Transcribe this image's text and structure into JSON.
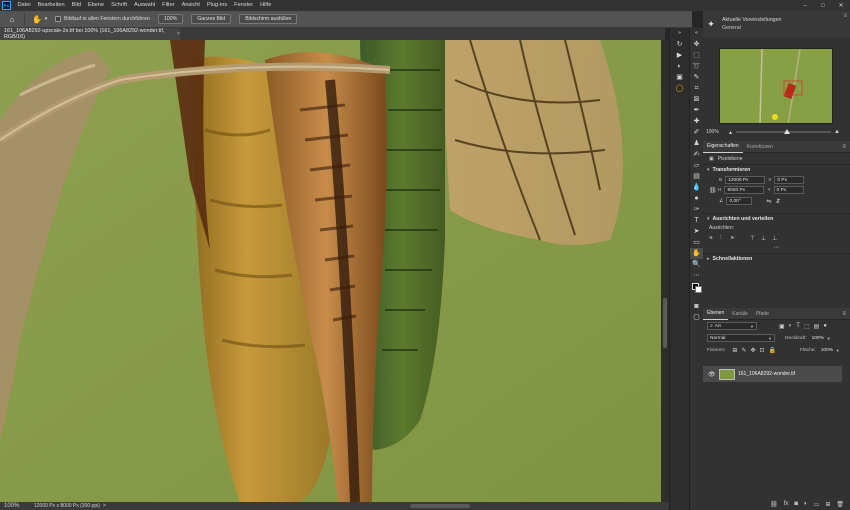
{
  "menu": {
    "logo": "Ps",
    "items": [
      "Datei",
      "Bearbeiten",
      "Bild",
      "Ebene",
      "Schrift",
      "Auswahl",
      "Filter",
      "Ansicht",
      "Plug-ins",
      "Fenster",
      "Hilfe"
    ]
  },
  "options": {
    "scroll_all_label": "Bildlauf in allen Fenstern durchführen",
    "zoom_100_label": "100%",
    "fit_screen_label": "Ganzes Bild",
    "fill_screen_label": "Bildschirm ausfüllen"
  },
  "document": {
    "tab_title": "161_106A8292-upscale-2x.tif bei 100% (161_106A8292-wonder.tif, RGB/16)",
    "close": "×"
  },
  "status": {
    "zoom": "100%",
    "info": "12000 Px x 8000 Px (300 ppi)",
    "arrow": ">"
  },
  "navigator": {
    "title": "Aktuelle Voreinstellungen",
    "subtitle": "General",
    "zoom": "100%"
  },
  "properties": {
    "tabs": [
      "Eigenschaften",
      "Korrekturen"
    ],
    "layer_type": "Pixelebene",
    "transform_title": "Transformieren",
    "width_label": "B",
    "width_value": "12000 Px",
    "height_label": "H",
    "height_value": "8000 Px",
    "x_label": "X",
    "x_value": "0 Px",
    "y_label": "Y",
    "y_value": "0 Px",
    "angle_value": "0,00°",
    "align_title": "Ausrichten und verteilen",
    "align_label": "Ausrichten:",
    "quick_actions_title": "Schnellaktionen"
  },
  "layers": {
    "tabs": [
      "Ebenen",
      "Kanäle",
      "Pfade"
    ],
    "filter_kind": "Art",
    "blend_mode": "Normal",
    "opacity_label": "Deckkraft:",
    "opacity_value": "100%",
    "lock_label": "Fixieren:",
    "fill_label": "Fläche:",
    "fill_value": "100%",
    "layer_name": "161_106A8292-wonder.tif"
  }
}
